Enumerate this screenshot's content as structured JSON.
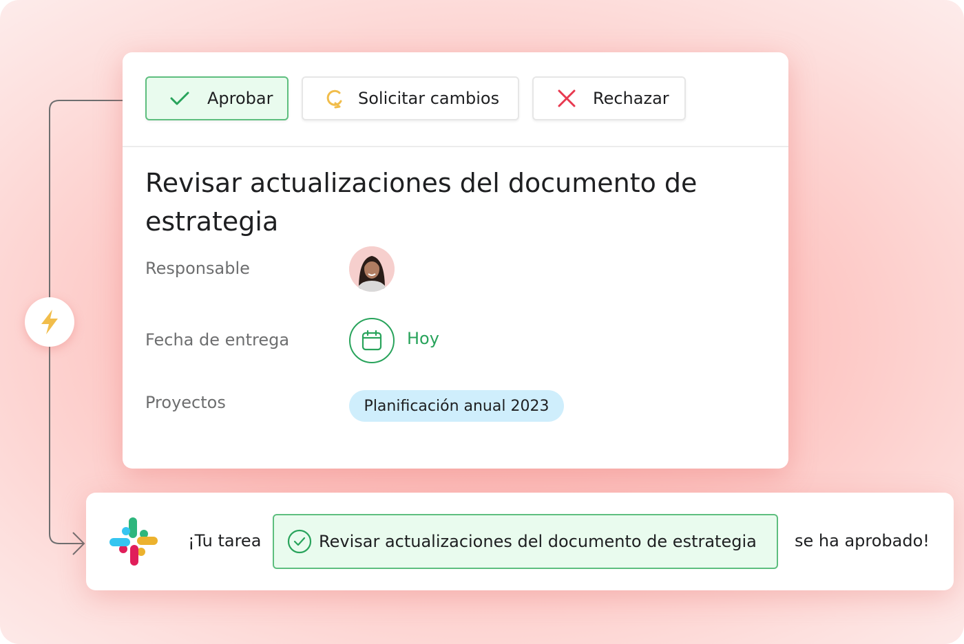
{
  "actions": {
    "approve_label": "Aprobar",
    "request_changes_label": "Solicitar cambios",
    "reject_label": "Rechazar"
  },
  "task": {
    "title": "Revisar actualizaciones del documento de estrategia",
    "fields": {
      "assignee_label": "Responsable",
      "due_date_label": "Fecha de entrega",
      "due_date_value": "Hoy",
      "projects_label": "Proyectos",
      "project_value": "Planificación anual 2023"
    }
  },
  "notification": {
    "prefix": "¡Tu tarea",
    "task_name": "Revisar actualizaciones del documento de estrategia",
    "suffix": "se ha aprobado!"
  },
  "icons": {
    "approve": "check-icon",
    "request_changes": "refresh-icon",
    "reject": "x-icon",
    "due_date": "calendar-icon",
    "rule": "lightning-bolt-icon",
    "app": "slack-logo-icon",
    "notif_status": "check-circle-icon"
  },
  "colors": {
    "success_green": "#28a35b",
    "approve_bg": "#e9fbee",
    "reject_red": "#e8384f",
    "changes_yellow": "#f1bd4b",
    "project_pill_bg": "#cfeefc"
  }
}
